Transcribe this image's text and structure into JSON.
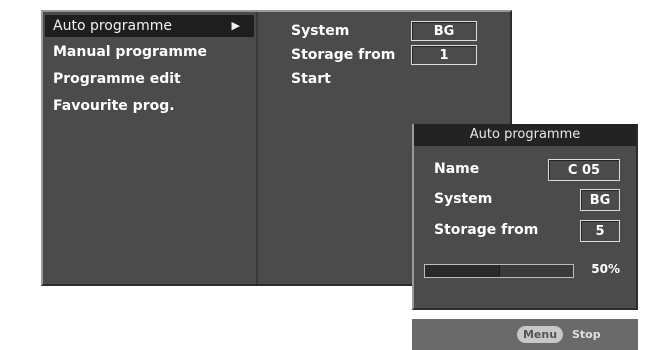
{
  "menu": {
    "items": [
      {
        "label": "Auto programme",
        "selected": true
      },
      {
        "label": "Manual programme",
        "selected": false
      },
      {
        "label": "Programme edit",
        "selected": false
      },
      {
        "label": "Favourite prog.",
        "selected": false
      }
    ],
    "arrow_glyph": "▶"
  },
  "submenu": {
    "system_label": "System",
    "system_value": "BG",
    "storage_label": "Storage from",
    "storage_value": "1",
    "start_label": "Start"
  },
  "dialog": {
    "title": "Auto programme",
    "name_label": "Name",
    "name_value": "C 05",
    "system_label": "System",
    "system_value": "BG",
    "storage_label": "Storage from",
    "storage_value": "5",
    "progress_percent": 50,
    "progress_text": "50%"
  },
  "bottom_bar": {
    "menu_button": "Menu",
    "stop_label": "Stop"
  },
  "colors": {
    "panel": "#4b4b4b",
    "selected": "#1e1e1e",
    "title_bar": "#232323",
    "bottom_bar": "#6a6a6a"
  }
}
